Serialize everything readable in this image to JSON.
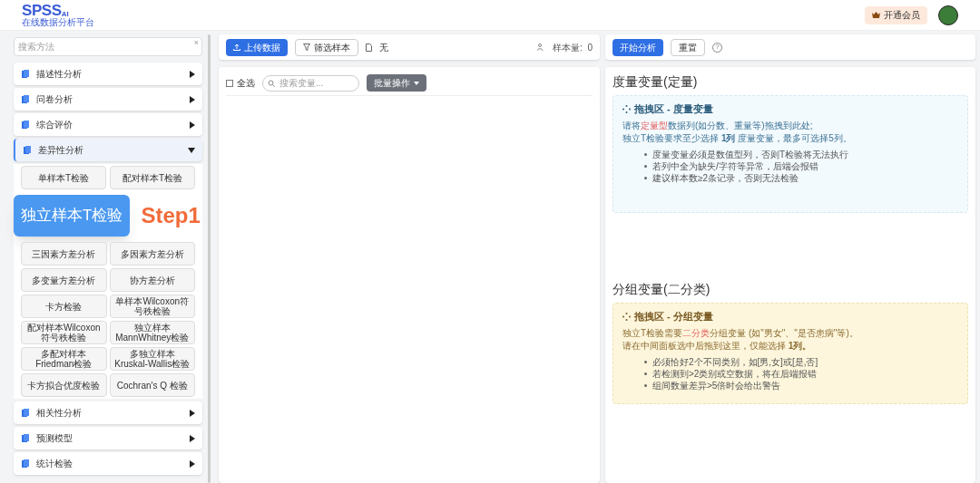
{
  "header": {
    "logo": "SPSS",
    "logo_sup": "AI",
    "subtitle": "在线数据分析平台",
    "member_button": "开通会员"
  },
  "sidebar": {
    "search": {
      "placeholder": "搜索方法"
    },
    "clear": "×",
    "groups_before": [
      {
        "label": "描述性分析",
        "expanded": false
      },
      {
        "label": "问卷分析",
        "expanded": false
      },
      {
        "label": "综合评价",
        "expanded": false
      }
    ],
    "open_group": {
      "label": "差异性分析",
      "expanded": true,
      "methods_top": [
        {
          "label": "单样本T检验"
        },
        {
          "label": "配对样本T检验"
        }
      ],
      "methods": [
        {
          "label": "三因素方差分析"
        },
        {
          "label": "多因素方差分析"
        },
        {
          "label": "多变量方差分析"
        },
        {
          "label": "协方差分析"
        },
        {
          "label": "卡方检验"
        },
        {
          "label": "单样本Wilcoxon符号秩检验"
        },
        {
          "label": "配对样本Wilcoxon符号秩检验"
        },
        {
          "label": "独立样本MannWhitney检验"
        },
        {
          "label": "多配对样本Friedman检验"
        },
        {
          "label": "多独立样本Kruskal-Wallis检验"
        },
        {
          "label": "卡方拟合优度检验"
        },
        {
          "label": "Cochran's Q 检验"
        }
      ]
    },
    "groups_after": [
      {
        "label": "相关性分析",
        "expanded": false
      },
      {
        "label": "预测模型",
        "expanded": false
      },
      {
        "label": "统计检验",
        "expanded": false
      }
    ]
  },
  "callout": {
    "label": "独立样本T检验",
    "step": "Step1"
  },
  "data_panel": {
    "upload": "上传数据",
    "filter": "筛选样本",
    "file": "无",
    "sample_count": "样本量:  0",
    "select_all": {
      "label": "全选",
      "checked": false
    },
    "search": {
      "placeholder": "搜索变量..."
    },
    "batch": "批量操作"
  },
  "analysis_panel": {
    "start": "开始分析",
    "reset": "重置",
    "help": "?",
    "zones": [
      {
        "kind": "metric",
        "heading": "度量变量(定量)",
        "title": "拖拽区 - 度量变量",
        "lines": [
          [
            {
              "text": "请将",
              "highlight": false
            },
            {
              "text": "定量型",
              "highlight": true
            },
            {
              "text": "数据列(如分数、重量等)拖拽到此处;",
              "highlight": false
            }
          ],
          [
            {
              "text": "独立T检验要求至少选择 **1列** 度量变量，最多可选择5列。",
              "highlight": false
            }
          ]
        ],
        "notes": [
          "度量变量必须是数值型列，否则T检验将无法执行",
          "若列中全为缺失/字符等异常，后端会报错",
          "建议样本数≥2条记录，否则无法检验"
        ]
      },
      {
        "kind": "group",
        "heading": "分组变量(二分类)",
        "title": "拖拽区 - 分组变量",
        "lines": [
          [
            {
              "text": "独立T检验需要",
              "highlight": false
            },
            {
              "text": "二分类",
              "highlight": true
            },
            {
              "text": "分组变量 (如\"男女\"、\"是否患病\"等)。",
              "highlight": false
            }
          ],
          [
            {
              "text": "请在中间面板选中后拖到这里，仅能选择 **1列。**",
              "highlight": false
            }
          ]
        ],
        "notes": [
          "必须恰好2个不同类别，如[男,女]或[是,否]",
          "若检测到>2类别或空数据，将在后端报错",
          "组间数量差异>5倍时会给出警告"
        ]
      }
    ]
  }
}
